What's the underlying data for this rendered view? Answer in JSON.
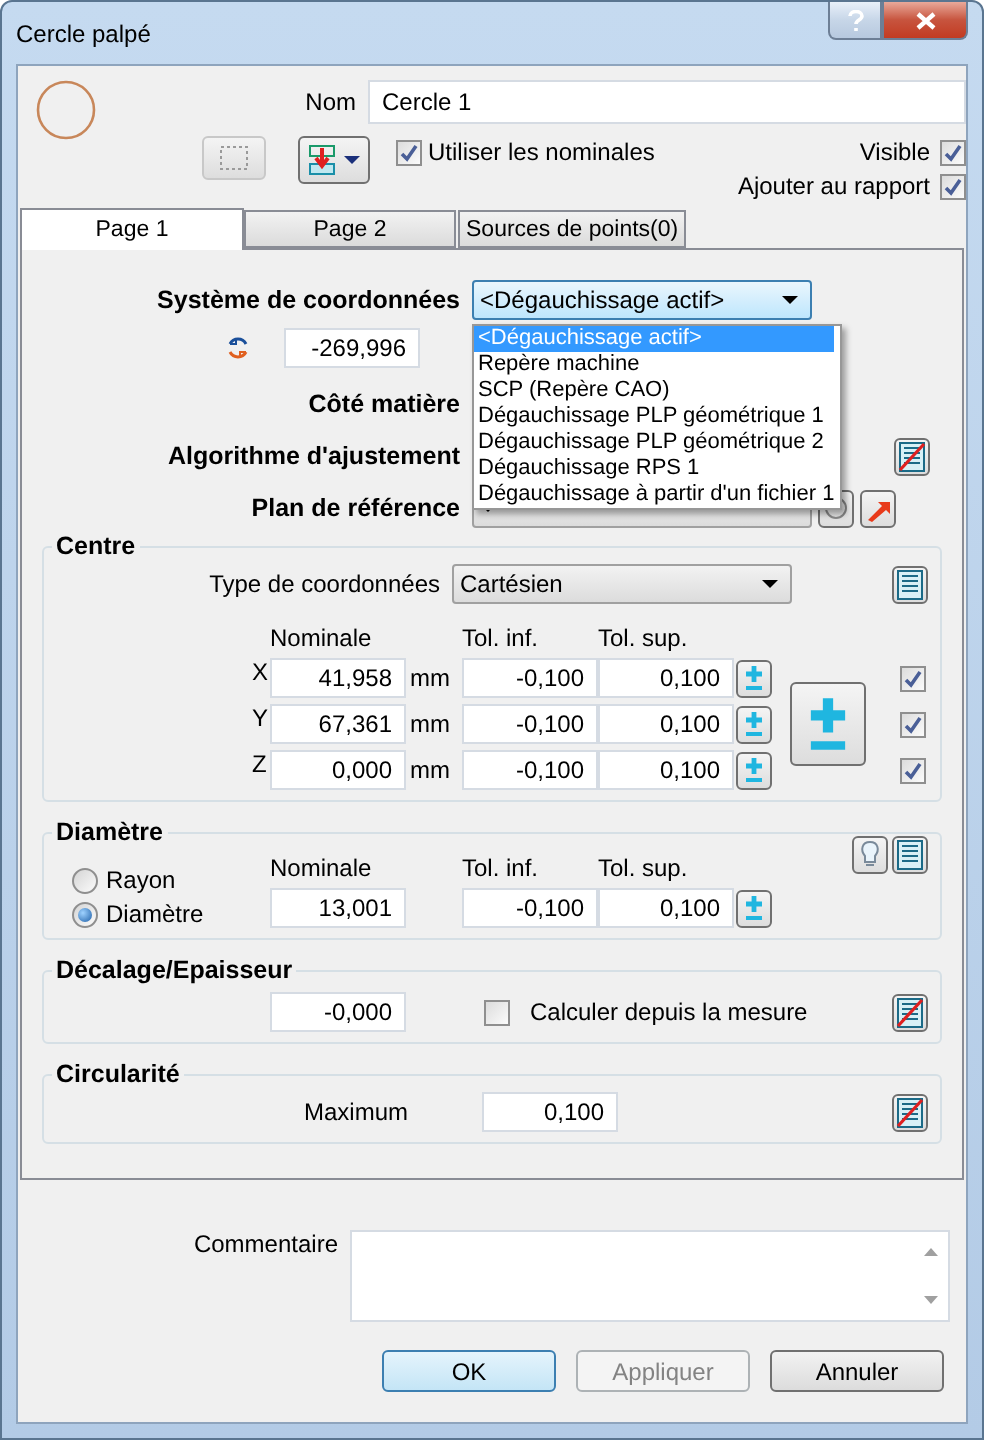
{
  "window": {
    "title": "Cercle palpé"
  },
  "header": {
    "name_label": "Nom",
    "name_value": "Cercle 1",
    "use_nominals": {
      "label": "Utiliser les nominales",
      "checked": true
    },
    "visible": {
      "label": "Visible",
      "checked": true
    },
    "add_to_report": {
      "label": "Ajouter au rapport",
      "checked": true
    }
  },
  "tabs": [
    {
      "label": "Page 1",
      "selected": true
    },
    {
      "label": "Page 2",
      "selected": false
    },
    {
      "label": "Sources de points(0)",
      "selected": false
    }
  ],
  "coordinate_system": {
    "label": "Système de coordonnées",
    "value": "<Dégauchissage actif>",
    "expanded": true,
    "options": [
      {
        "label": "<Dégauchissage actif>",
        "selected": true
      },
      {
        "label": "Repère machine",
        "selected": false
      },
      {
        "label": "SCP (Repère CAO)",
        "selected": false
      },
      {
        "label": "Dégauchissage PLP géométrique 1",
        "selected": false
      },
      {
        "label": "Dégauchissage PLP géométrique 2",
        "selected": false
      },
      {
        "label": "Dégauchissage RPS 1",
        "selected": false
      },
      {
        "label": "Dégauchissage à partir d'un fichier 1",
        "selected": false
      }
    ]
  },
  "angle_value": "-269,996",
  "material_side": {
    "label": "Côté matière"
  },
  "fit_algorithm": {
    "label": "Algorithme d'ajustement"
  },
  "reference_plane": {
    "label": "Plan de référence"
  },
  "centre": {
    "title": "Centre",
    "coord_type_label": "Type de coordonnées",
    "coord_type": "Cartésien",
    "headers": [
      "Nominale",
      "Tol. inf.",
      "Tol. sup."
    ],
    "rows": [
      {
        "axis": "X",
        "nominal": "41,958",
        "unit": "mm",
        "tol_inf": "-0,100",
        "tol_sup": "0,100",
        "checked": true
      },
      {
        "axis": "Y",
        "nominal": "67,361",
        "unit": "mm",
        "tol_inf": "-0,100",
        "tol_sup": "0,100",
        "checked": true
      },
      {
        "axis": "Z",
        "nominal": "0,000",
        "unit": "mm",
        "tol_inf": "-0,100",
        "tol_sup": "0,100",
        "checked": true
      }
    ]
  },
  "diameter": {
    "title": "Diamètre",
    "modes": [
      {
        "label": "Rayon",
        "selected": false
      },
      {
        "label": "Diamètre",
        "selected": true
      }
    ],
    "headers": [
      "Nominale",
      "Tol. inf.",
      "Tol. sup."
    ],
    "nominal": "13,001",
    "tol_inf": "-0,100",
    "tol_sup": "0,100"
  },
  "offset": {
    "title": "Décalage/Epaisseur",
    "value": "-0,000",
    "compute": {
      "label": "Calculer depuis la mesure",
      "checked": false
    }
  },
  "circularity": {
    "title": "Circularité",
    "label": "Maximum",
    "value": "0,100"
  },
  "comment": {
    "label": "Commentaire"
  },
  "buttons": [
    {
      "label": "OK",
      "kind": "default",
      "disabled": false
    },
    {
      "label": "Appliquer",
      "kind": "normal",
      "disabled": true
    },
    {
      "label": "Annuler",
      "kind": "normal",
      "disabled": false
    }
  ]
}
